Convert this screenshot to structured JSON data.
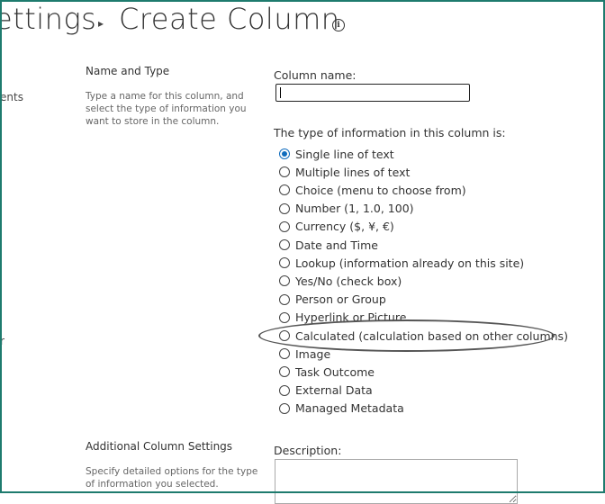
{
  "header": {
    "breadcrumb_prev": "ettings",
    "separator": "▸",
    "title": "Create Column",
    "info_icon": "info-icon"
  },
  "left_nav": {
    "fragment_1": "ents",
    "fragment_2": "r"
  },
  "name_type": {
    "title": "Name and Type",
    "description": "Type a name for this column, and select the type of information you want to store in the column.",
    "column_name_label": "Column name:",
    "column_name_value": "",
    "type_label": "The type of information in this column is:",
    "options": [
      {
        "label": "Single line of text",
        "checked": true
      },
      {
        "label": "Multiple lines of text",
        "checked": false
      },
      {
        "label": "Choice (menu to choose from)",
        "checked": false
      },
      {
        "label": "Number (1, 1.0, 100)",
        "checked": false
      },
      {
        "label": "Currency ($, ¥, €)",
        "checked": false
      },
      {
        "label": "Date and Time",
        "checked": false
      },
      {
        "label": "Lookup (information already on this site)",
        "checked": false
      },
      {
        "label": "Yes/No (check box)",
        "checked": false
      },
      {
        "label": "Person or Group",
        "checked": false
      },
      {
        "label": "Hyperlink or Picture",
        "checked": false
      },
      {
        "label": "Calculated (calculation based on other columns)",
        "checked": false
      },
      {
        "label": "Image",
        "checked": false
      },
      {
        "label": "Task Outcome",
        "checked": false
      },
      {
        "label": "External Data",
        "checked": false
      },
      {
        "label": "Managed Metadata",
        "checked": false
      }
    ]
  },
  "additional": {
    "title": "Additional Column Settings",
    "description": "Specify detailed options for the type of information you selected.",
    "description_label": "Description:"
  },
  "colors": {
    "frame": "#1e7b6e",
    "radio_selected": "#0f6cbd"
  }
}
